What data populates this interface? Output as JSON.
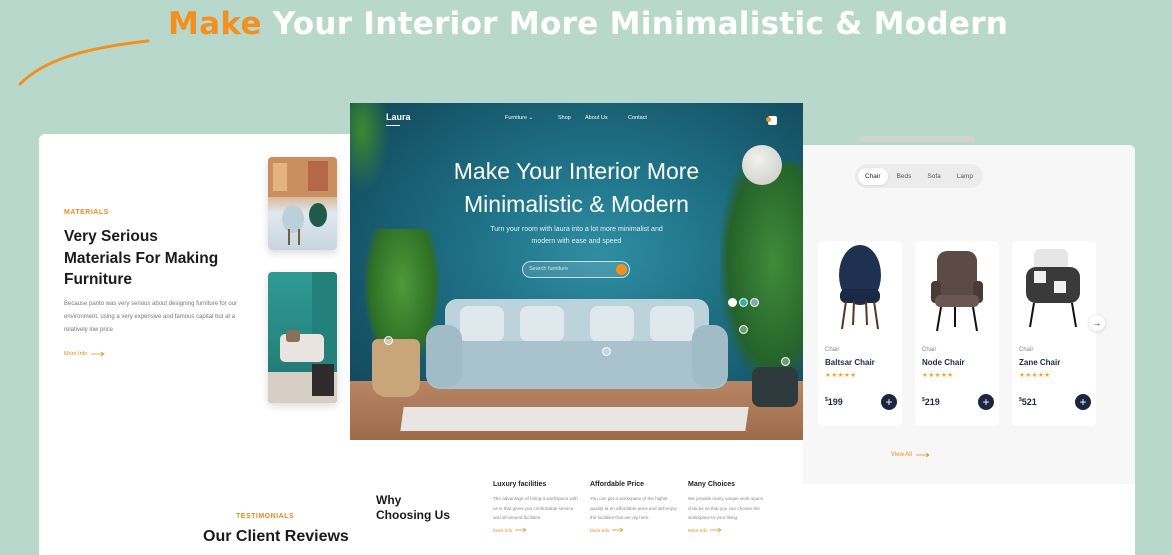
{
  "headline": {
    "accent": "Make",
    "rest": " Your Interior More Minimalistic & Modern"
  },
  "left_card": {
    "materials_tag": "MATERIALS",
    "materials_title": [
      "Very Serious",
      "Materials For Making",
      "Furniture"
    ],
    "materials_body": "Because panto was very serious about designing furniture for our environment, using a very expensive and famous capital but at a relatively low price",
    "more_info": "More Info",
    "testimonials_tag": "TESTIMONIALS",
    "testimonials_title": "Our Client Reviews"
  },
  "hero": {
    "logo": "Laura",
    "nav": [
      "Furniture",
      "Shop",
      "About Us",
      "Contact"
    ],
    "title": [
      "Make Your Interior More",
      "Minimalistic & Modern"
    ],
    "subtitle": [
      "Turn your room with laura into a lot more minimalist and",
      "modern with ease and speed"
    ],
    "search_placeholder": "Search furniture"
  },
  "why": {
    "title": [
      "Why",
      "Choosing Us"
    ],
    "features": [
      {
        "title": "Luxury facilities",
        "body": "The advantage of hiring a workspace with us is that gives you comfortable service and all-around facilities.",
        "link": "More Info"
      },
      {
        "title": "Affordable Price",
        "body": "You can get a workspace of the highst quality at an affordable price and still enjoy the facilities that are oly here.",
        "link": "More Info"
      },
      {
        "title": "Many Choices",
        "body": "We provide many unique work space choices so that you can choose the workspace to your liking.",
        "link": "More Info"
      }
    ]
  },
  "right_card": {
    "tabs": [
      "Chair",
      "Beds",
      "Sofa",
      "Lamp"
    ],
    "active_tab": "Chair",
    "products": [
      {
        "category": "Chair",
        "name": "Baltsar Chair",
        "stars": "★★★★★",
        "currency": "$",
        "price": "199",
        "color": "#1f3150"
      },
      {
        "category": "Chair",
        "name": "Node Chair",
        "stars": "★★★★★",
        "currency": "$",
        "price": "219",
        "color": "#5b4a45"
      },
      {
        "category": "Chair",
        "name": "Zane Chair",
        "stars": "★★★★★",
        "currency": "$",
        "price": "521",
        "color": "#3a3a3a"
      }
    ],
    "view_all": "View All"
  },
  "colors": {
    "accent": "#f3901f",
    "background": "#b9d8cc",
    "navy": "#1d2641"
  }
}
